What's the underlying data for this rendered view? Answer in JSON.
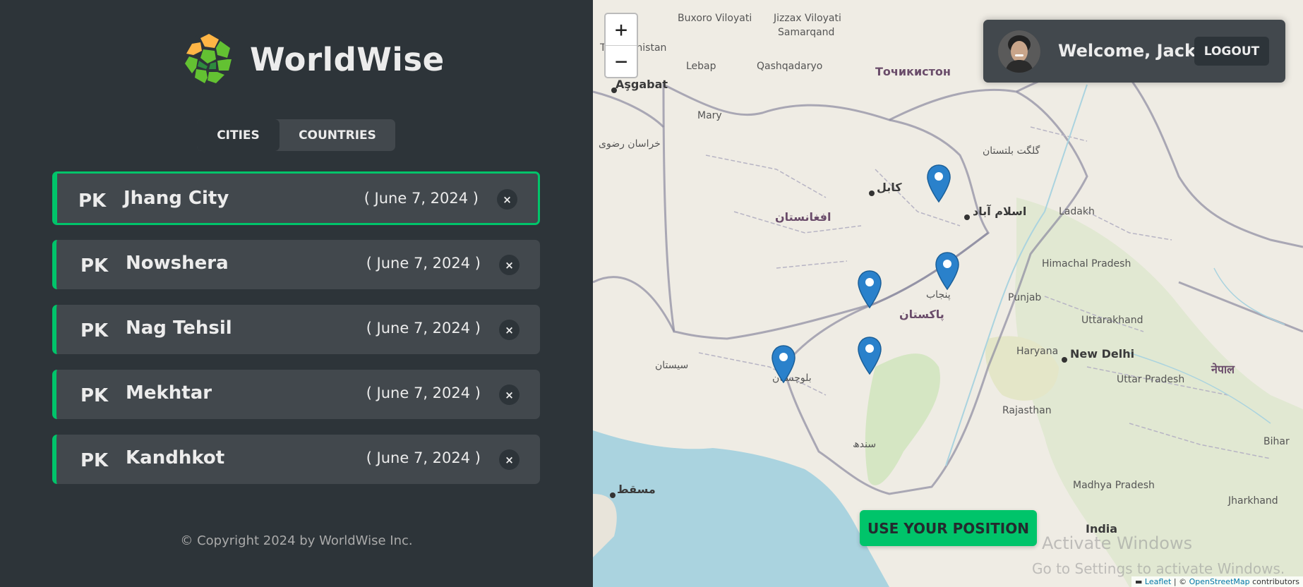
{
  "app": {
    "name": "WorldWise"
  },
  "tabs": [
    {
      "label": "CITIES",
      "active": true
    },
    {
      "label": "COUNTRIES",
      "active": false
    }
  ],
  "cities": [
    {
      "code": "PK",
      "name": "Jhang City",
      "date": "( June 7, 2024 )",
      "active": true
    },
    {
      "code": "PK",
      "name": "Nowshera",
      "date": "( June 7, 2024 )",
      "active": false
    },
    {
      "code": "PK",
      "name": "Nag Tehsil",
      "date": "( June 7, 2024 )",
      "active": false
    },
    {
      "code": "PK",
      "name": "Mekhtar",
      "date": "( June 7, 2024 )",
      "active": false
    },
    {
      "code": "PK",
      "name": "Kandhkot",
      "date": "( June 7, 2024 )",
      "active": false
    }
  ],
  "delete_symbol": "×",
  "footer": "© Copyright 2024 by WorldWise Inc.",
  "map": {
    "zoom_in": "+",
    "zoom_out": "−",
    "user": {
      "welcome": "Welcome, Jack",
      "logout": "LOGOUT"
    },
    "use_position": "USE YOUR POSITION",
    "labels": {
      "turkmenistan": "Turkmenistan",
      "ashgabat": "Aşgabat",
      "tajikistan": "Точикистон",
      "afghanistan": "افغانستان",
      "kabul": "کابل",
      "islamabad": "اسلام آباد",
      "pakistan": "پاکستان",
      "new_delhi": "New Delhi",
      "nepal": "नेपाल",
      "muscat": "مسقط",
      "india": "India",
      "punjab": "Punjab",
      "ladakh": "Ladakh",
      "himachal": "Himachal Pradesh",
      "uttarakhand": "Uttarakhand",
      "haryana": "Haryana",
      "uttar_pradesh": "Uttar Pradesh",
      "rajasthan": "Rajasthan",
      "madhya": "Madhya Pradesh",
      "jharkhand": "Jharkhand",
      "bihar": "Bihar",
      "bukhoro": "Buxoro Viloyati",
      "jizzax": "Jizzax Viloyati",
      "samarqand": "Samarqand",
      "qashqadaryo": "Qashqadaryo",
      "lebap": "Lebap",
      "mary": "Mary",
      "balochistan": "بلوچستان",
      "sindh": "سندھ",
      "gilgit": "گلگت بلتستان",
      "khorasan": "خراسان رضوی",
      "sistan": "سیستان",
      "punjab_ur": "پنجاب"
    },
    "watermark_1": "Activate Windows",
    "watermark_2": "Go to Settings to activate Windows.",
    "attribution": {
      "leaflet": "Leaflet",
      "sep": " | © ",
      "osm": "OpenStreetMap",
      "contrib": " contributors"
    }
  },
  "colors": {
    "accent": "#00c46a",
    "sidebar": "#2d3439",
    "card": "#42484d",
    "marker": "#2a81cb"
  }
}
